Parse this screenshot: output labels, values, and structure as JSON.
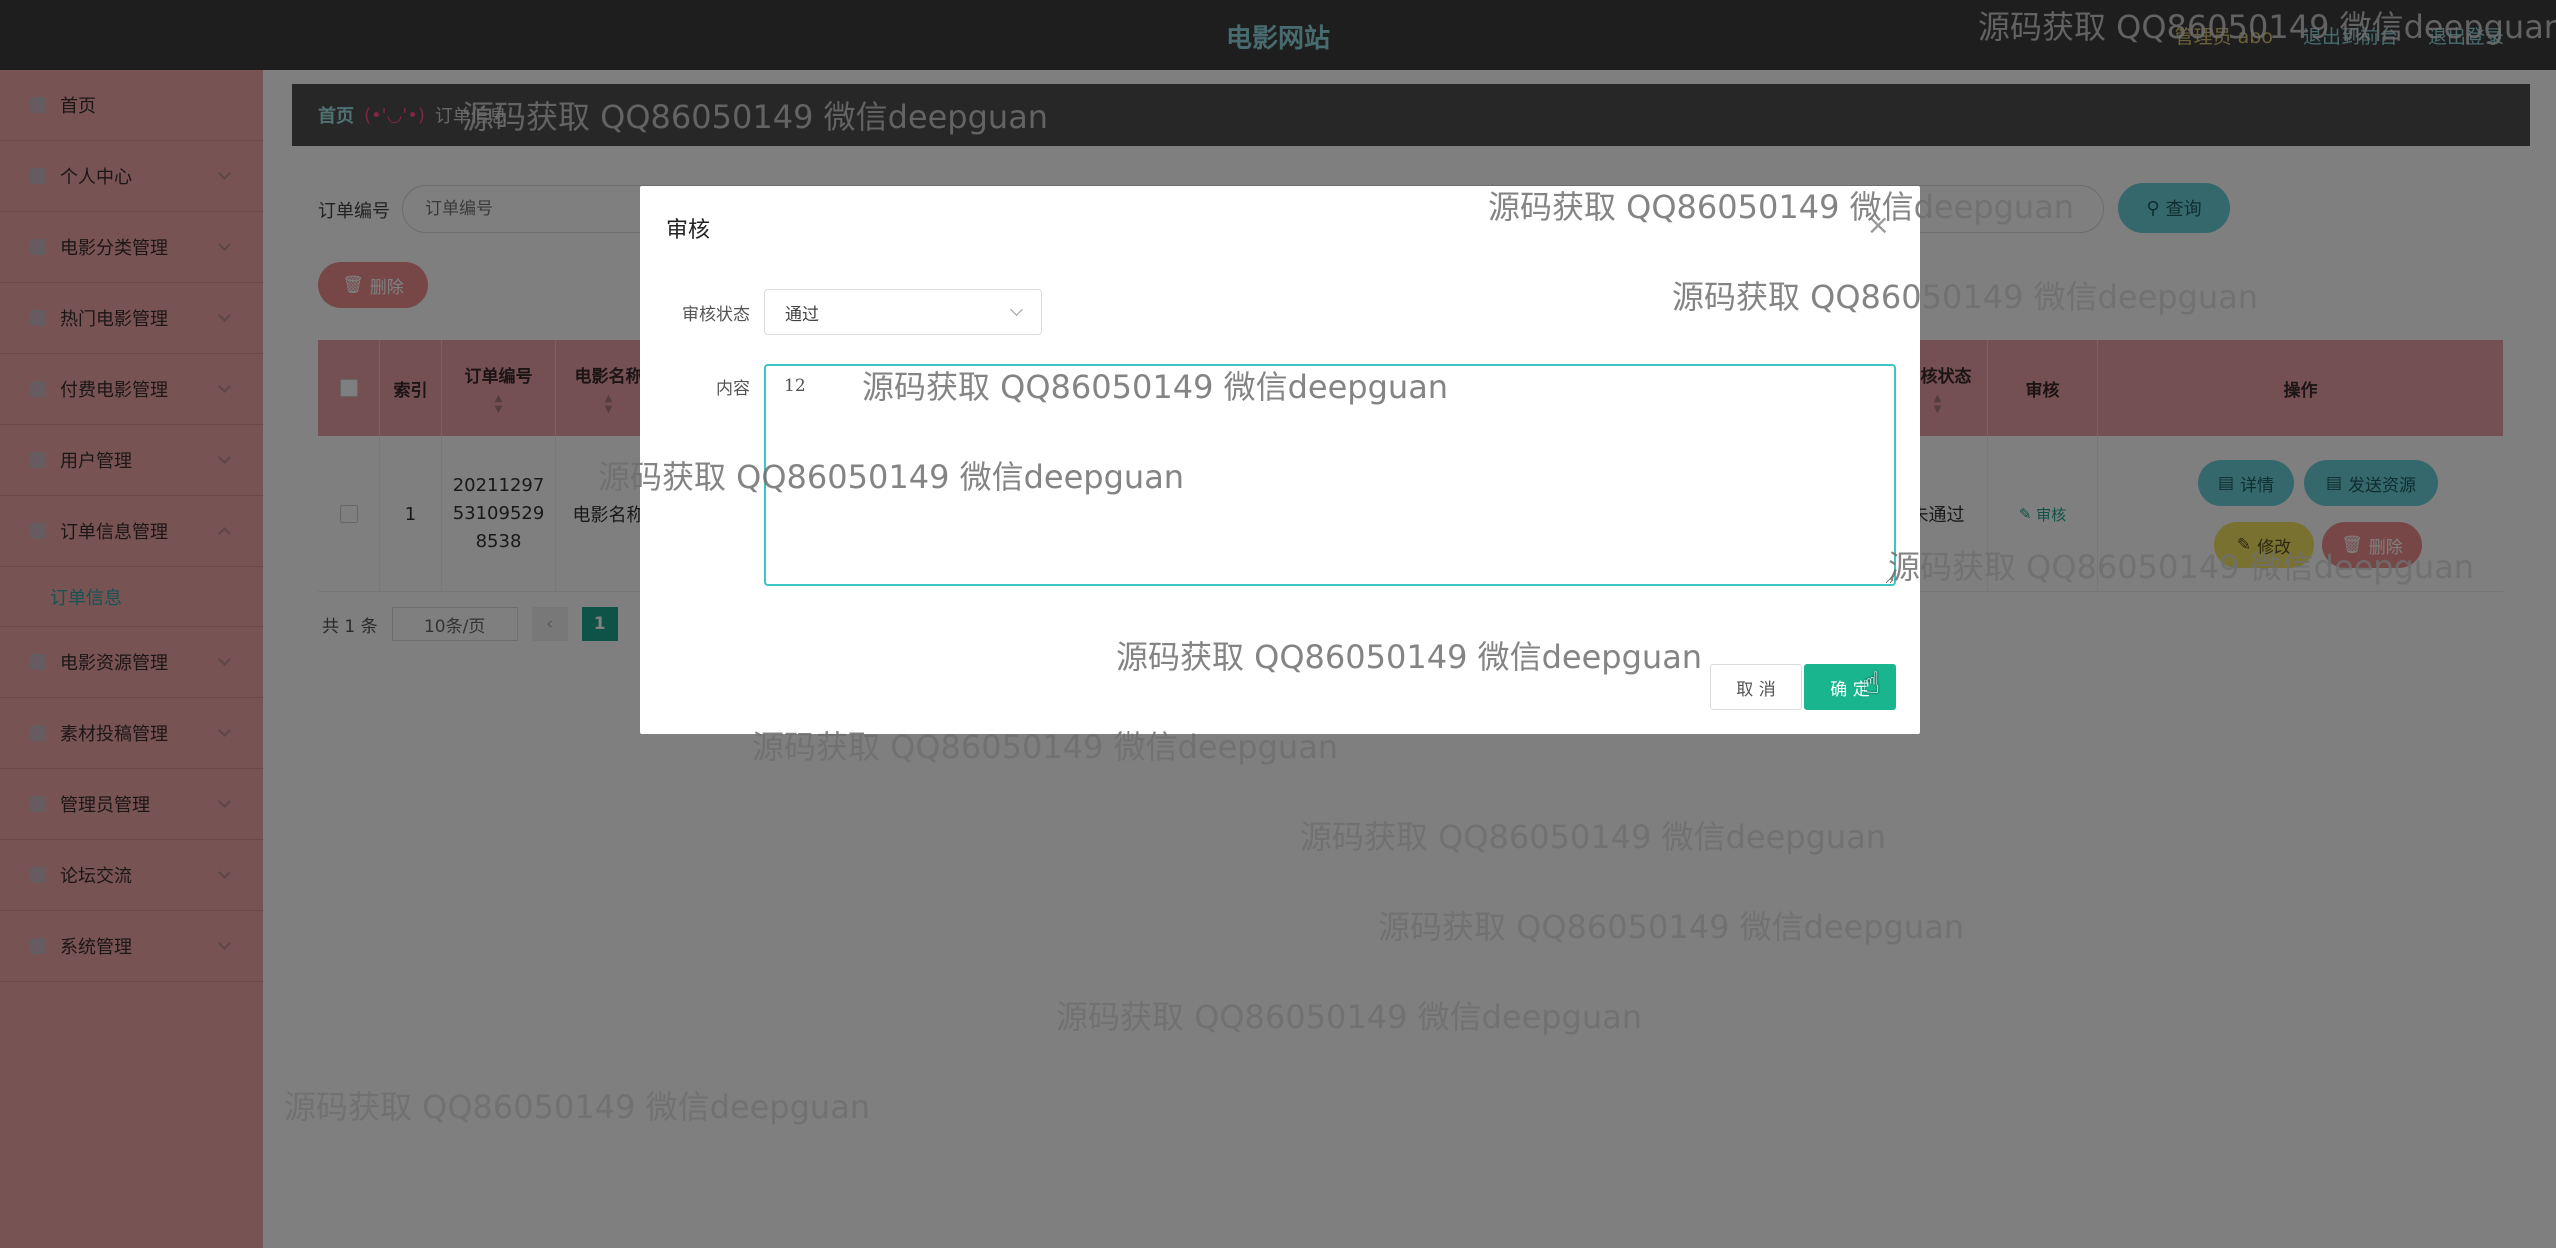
{
  "header": {
    "site_title": "电影网站",
    "user_label": "管理员 abo",
    "goto_front": "退出到前台",
    "logout": "退出登录"
  },
  "sidebar": {
    "items": [
      {
        "label": "首页",
        "has_children": false
      },
      {
        "label": "个人中心",
        "has_children": true
      },
      {
        "label": "电影分类管理",
        "has_children": true
      },
      {
        "label": "热门电影管理",
        "has_children": true
      },
      {
        "label": "付费电影管理",
        "has_children": true
      },
      {
        "label": "用户管理",
        "has_children": true
      },
      {
        "label": "订单信息管理",
        "has_children": true
      },
      {
        "label": "电影资源管理",
        "has_children": true
      },
      {
        "label": "素材投稿管理",
        "has_children": true
      },
      {
        "label": "管理员管理",
        "has_children": true
      },
      {
        "label": "论坛交流",
        "has_children": true
      },
      {
        "label": "系统管理",
        "has_children": true
      }
    ],
    "submenu_order_info": "订单信息"
  },
  "breadcrumb": {
    "home": "首页",
    "face": "(•'◡'•)",
    "current": "订单信息"
  },
  "search": {
    "label": "订单编号",
    "placeholder": "订单编号",
    "query_button": "查询"
  },
  "toolbar": {
    "delete_button": "删除"
  },
  "table": {
    "headers": {
      "index": "索引",
      "order_no": "订单编号",
      "movie_name": "电影名称",
      "audit_status": "审核状态",
      "audit": "审核",
      "actions": "操作"
    },
    "rows": [
      {
        "index": "1",
        "order_no": "20211297 53109529 8538",
        "movie_name": "电影名称",
        "audit_status": "未通过",
        "audit_link": "审核",
        "actions": {
          "detail": "详情",
          "send_resource": "发送资源",
          "edit": "修改",
          "delete": "删除"
        }
      }
    ]
  },
  "pagination": {
    "total": "共 1 条",
    "page_size": "10条/页",
    "current_page": "1"
  },
  "dialog": {
    "title": "审核",
    "status_label": "审核状态",
    "status_value": "通过",
    "content_label": "内容",
    "content_value": "12",
    "cancel": "取 消",
    "confirm": "确 定"
  },
  "watermark": "源码获取 QQ86050149 微信deepguan",
  "colors": {
    "header_bg": "#3d3d3d",
    "sidebar_bg": "#efa6a9",
    "accent_teal": "#6ad0d8",
    "confirm_green": "#19b58f",
    "danger": "#ef8e8e"
  }
}
